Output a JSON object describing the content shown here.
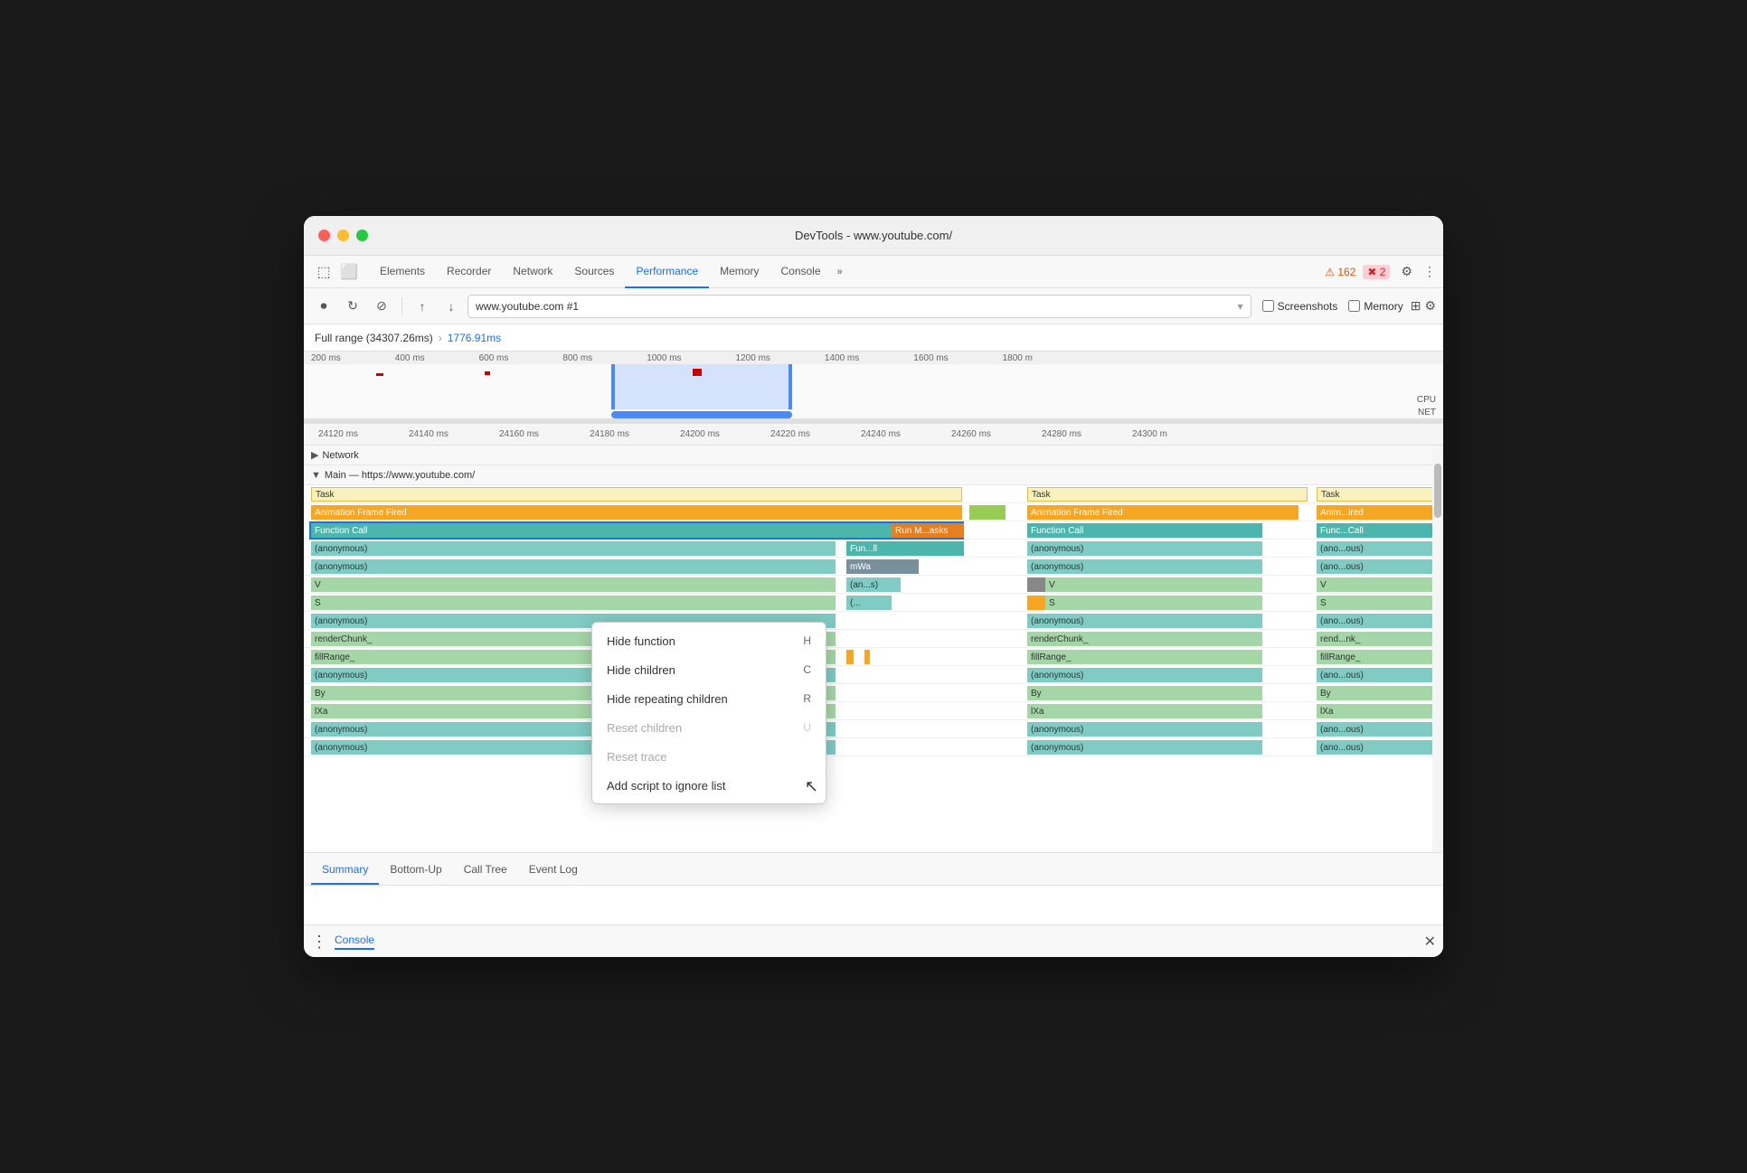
{
  "window": {
    "title": "DevTools - www.youtube.com/"
  },
  "tabs": {
    "items": [
      {
        "label": "Elements",
        "active": false
      },
      {
        "label": "Recorder",
        "active": false
      },
      {
        "label": "Network",
        "active": false
      },
      {
        "label": "Sources",
        "active": false
      },
      {
        "label": "Performance",
        "active": true
      },
      {
        "label": "Memory",
        "active": false
      },
      {
        "label": "Console",
        "active": false
      }
    ],
    "more_label": "»",
    "alerts": {
      "warn": "⚠ 162",
      "error": "✖ 2"
    }
  },
  "toolbar": {
    "url": "www.youtube.com #1",
    "screenshots_label": "Screenshots",
    "memory_label": "Memory"
  },
  "range": {
    "full": "Full range (34307.26ms)",
    "arrow": "›",
    "selected": "1776.91ms"
  },
  "timeline": {
    "labels": [
      "24120 ms",
      "24140 ms",
      "24160 ms",
      "24180 ms",
      "24200 ms",
      "24220 ms",
      "24240 ms",
      "24260 ms",
      "24280 ms",
      "24300 m"
    ],
    "cpu_label": "CPU",
    "net_label": "NET"
  },
  "overview_labels": [
    "200 ms",
    "400 ms",
    "600 ms",
    "800 ms",
    "1000 ms",
    "1200 ms",
    "1400 ms",
    "1600 ms",
    "1800 m"
  ],
  "sections": {
    "network": {
      "label": "Network",
      "collapsed": true
    },
    "main": {
      "label": "Main — https://www.youtube.com/",
      "collapsed": false
    }
  },
  "tracks": [
    {
      "label": "Task",
      "type": "task"
    },
    {
      "label": "Animation Frame Fired",
      "type": "animation"
    },
    {
      "label": "Function Call",
      "type": "function"
    },
    {
      "label": "(anonymous)",
      "type": "anon"
    },
    {
      "label": "(anonymous)",
      "type": "anon"
    },
    {
      "label": "V",
      "type": "green"
    },
    {
      "label": "S",
      "type": "green"
    },
    {
      "label": "(anonymous)",
      "type": "anon"
    },
    {
      "label": "renderChunk_",
      "type": "green"
    },
    {
      "label": "fillRange_",
      "type": "green"
    },
    {
      "label": "(anonymous)",
      "type": "anon"
    },
    {
      "label": "By",
      "type": "green"
    },
    {
      "label": "lXa",
      "type": "green"
    },
    {
      "label": "(anonymous)",
      "type": "anon"
    },
    {
      "label": "(anonymous)",
      "type": "anon"
    }
  ],
  "context_menu": {
    "items": [
      {
        "label": "Hide function",
        "key": "H",
        "disabled": false
      },
      {
        "label": "Hide children",
        "key": "C",
        "disabled": false
      },
      {
        "label": "Hide repeating children",
        "key": "R",
        "disabled": false
      },
      {
        "label": "Reset children",
        "key": "U",
        "disabled": true
      },
      {
        "label": "Reset trace",
        "key": "",
        "disabled": true
      },
      {
        "label": "Add script to ignore list",
        "key": "",
        "disabled": false
      }
    ]
  },
  "bottom_tabs": [
    {
      "label": "Summary",
      "active": true
    },
    {
      "label": "Bottom-Up",
      "active": false
    },
    {
      "label": "Call Tree",
      "active": false
    },
    {
      "label": "Event Log",
      "active": false
    }
  ],
  "console": {
    "dots": "⋮",
    "label": "Console",
    "close": "✕"
  }
}
